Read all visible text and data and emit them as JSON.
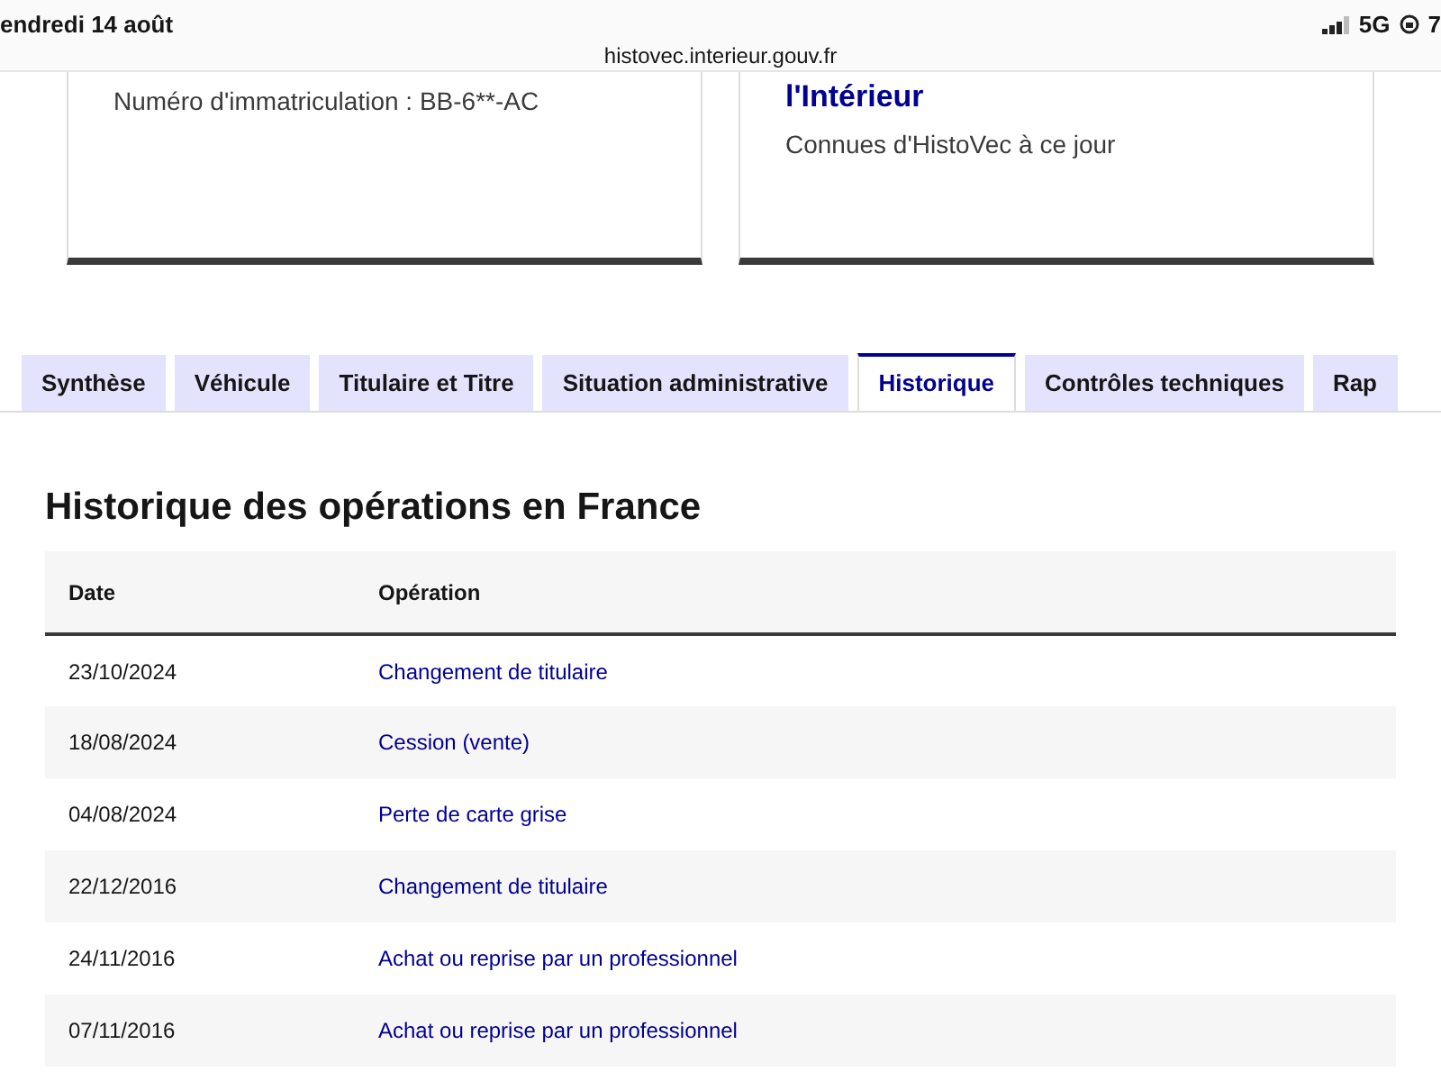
{
  "status_bar": {
    "date": "endredi 14 août",
    "network": "5G",
    "time": "7",
    "url": "histovec.interieur.gouv.fr"
  },
  "cards": [
    {
      "text": "Numéro d'immatriculation : BB-6**-AC"
    },
    {
      "title": "l'Intérieur",
      "text": "Connues d'HistoVec à ce jour"
    }
  ],
  "tabs": [
    {
      "label": "Synthèse",
      "selected": false
    },
    {
      "label": "Véhicule",
      "selected": false
    },
    {
      "label": "Titulaire et Titre",
      "selected": false
    },
    {
      "label": "Situation administrative",
      "selected": false
    },
    {
      "label": "Historique",
      "selected": true
    },
    {
      "label": "Contrôles techniques",
      "selected": false
    },
    {
      "label": "Rap",
      "selected": false
    }
  ],
  "section": {
    "title": "Historique des opérations en France"
  },
  "table": {
    "columns": [
      "Date",
      "Opération"
    ],
    "rows": [
      [
        "23/10/2024",
        "Changement de titulaire"
      ],
      [
        "18/08/2024",
        "Cession (vente)"
      ],
      [
        "04/08/2024",
        "Perte de carte grise"
      ],
      [
        "22/12/2016",
        "Changement de titulaire"
      ],
      [
        "24/11/2016",
        "Achat ou reprise par un professionnel"
      ],
      [
        "07/11/2016",
        "Achat ou reprise par un professionnel"
      ]
    ]
  }
}
